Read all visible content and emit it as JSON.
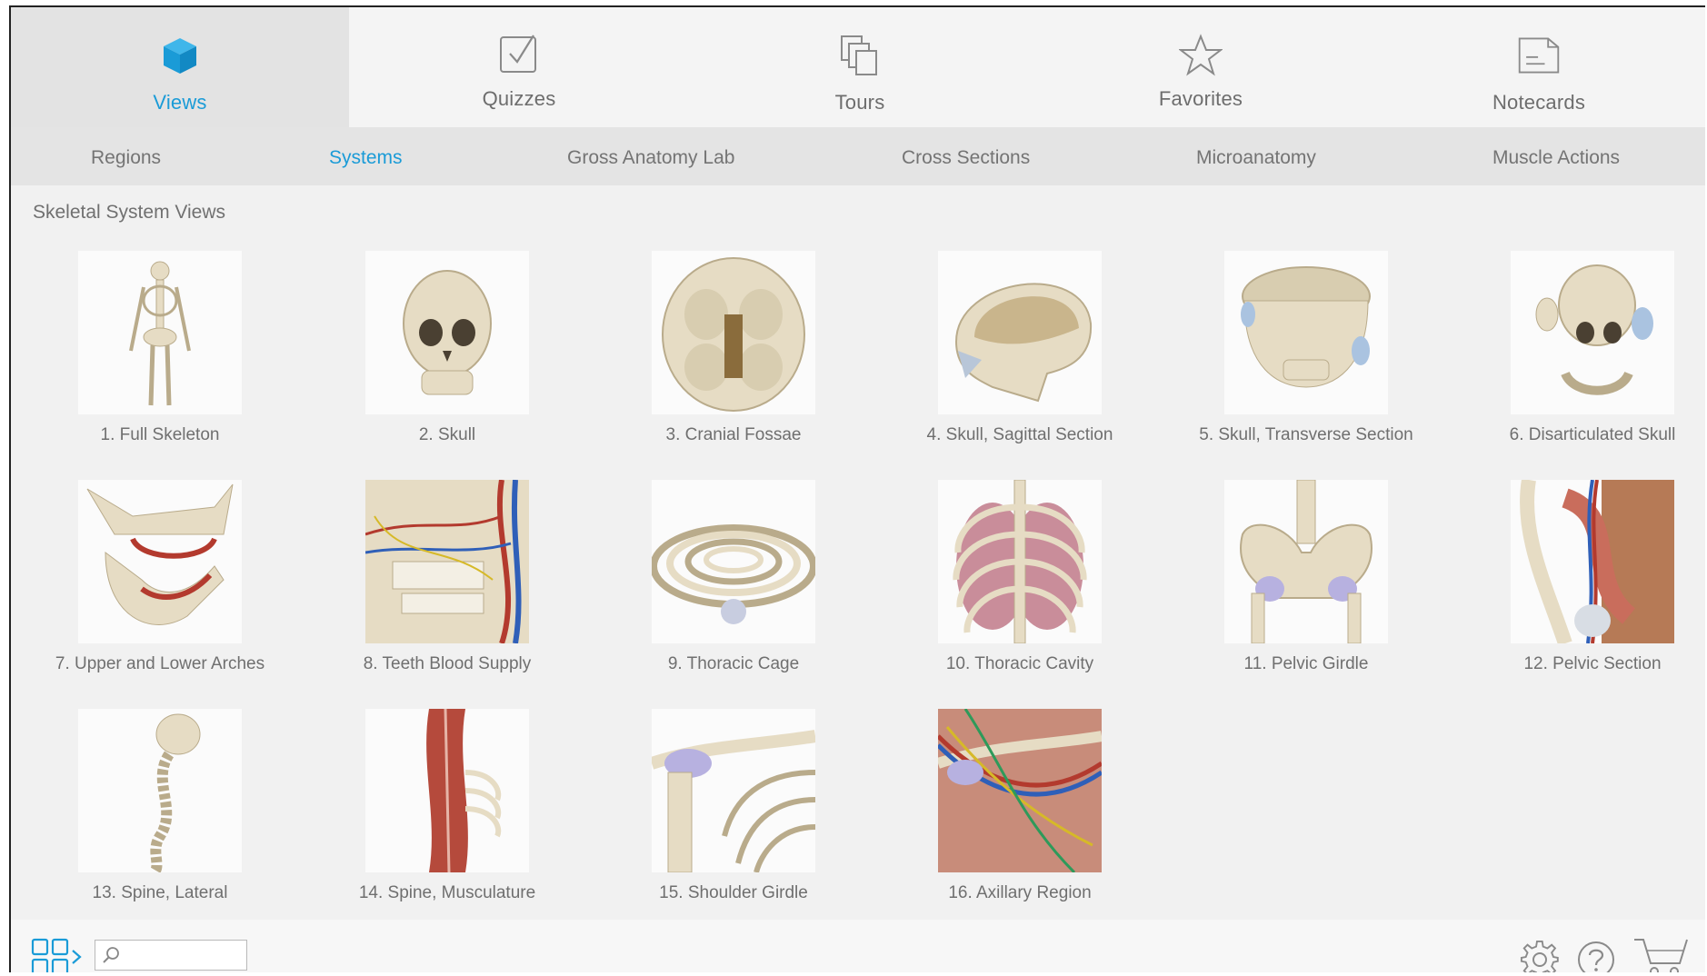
{
  "colors": {
    "accent": "#1a9bd7",
    "text": "#6f6f6f"
  },
  "top_tabs": [
    {
      "label": "Views",
      "icon": "cube-icon",
      "active": true
    },
    {
      "label": "Quizzes",
      "icon": "checkbox-icon",
      "active": false
    },
    {
      "label": "Tours",
      "icon": "stacked-pages-icon",
      "active": false
    },
    {
      "label": "Favorites",
      "icon": "star-icon",
      "active": false
    },
    {
      "label": "Notecards",
      "icon": "notecard-icon",
      "active": false
    }
  ],
  "sub_tabs": [
    {
      "label": "Regions",
      "active": false
    },
    {
      "label": "Systems",
      "active": true
    },
    {
      "label": "Gross Anatomy Lab",
      "active": false
    },
    {
      "label": "Cross Sections",
      "active": false
    },
    {
      "label": "Microanatomy",
      "active": false
    },
    {
      "label": "Muscle Actions",
      "active": false
    }
  ],
  "section_title": "Skeletal System Views",
  "views": [
    {
      "label": "1. Full Skeleton",
      "thumb": "full-skeleton"
    },
    {
      "label": "2. Skull",
      "thumb": "skull"
    },
    {
      "label": "3. Cranial Fossae",
      "thumb": "cranial-fossae"
    },
    {
      "label": "4. Skull, Sagittal Section",
      "thumb": "skull-sagittal"
    },
    {
      "label": "5. Skull, Transverse Section",
      "thumb": "skull-transverse"
    },
    {
      "label": "6. Disarticulated Skull",
      "thumb": "disarticulated-skull"
    },
    {
      "label": "7. Upper and Lower Arches",
      "thumb": "arches"
    },
    {
      "label": "8. Teeth Blood Supply",
      "thumb": "teeth-blood"
    },
    {
      "label": "9. Thoracic Cage",
      "thumb": "thoracic-cage"
    },
    {
      "label": "10. Thoracic Cavity",
      "thumb": "thoracic-cavity"
    },
    {
      "label": "11. Pelvic Girdle",
      "thumb": "pelvic-girdle"
    },
    {
      "label": "12. Pelvic Section",
      "thumb": "pelvic-section"
    },
    {
      "label": "13. Spine, Lateral",
      "thumb": "spine-lateral"
    },
    {
      "label": "14. Spine, Musculature",
      "thumb": "spine-muscle"
    },
    {
      "label": "15. Shoulder Girdle",
      "thumb": "shoulder-girdle"
    },
    {
      "label": "16. Axillary Region",
      "thumb": "axillary"
    }
  ],
  "bottom": {
    "search_value": "",
    "icons": [
      "grid-view-icon",
      "search-icon",
      "settings-gear-icon",
      "help-icon",
      "cart-icon"
    ]
  }
}
